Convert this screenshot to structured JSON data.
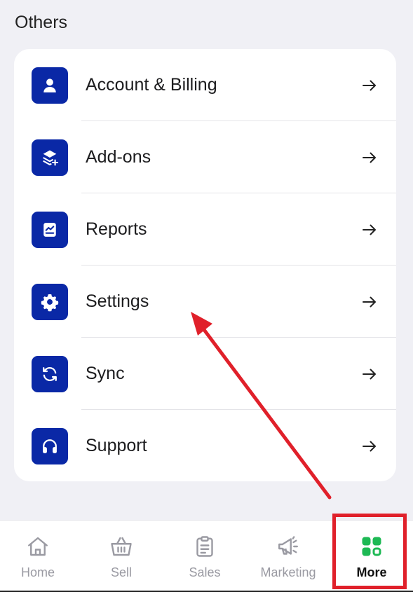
{
  "section": {
    "title": "Others"
  },
  "menu": [
    {
      "label": "Account & Billing",
      "icon": "person-icon"
    },
    {
      "label": "Add-ons",
      "icon": "layers-plus-icon"
    },
    {
      "label": "Reports",
      "icon": "report-chart-icon"
    },
    {
      "label": "Settings",
      "icon": "gear-icon"
    },
    {
      "label": "Sync",
      "icon": "sync-icon"
    },
    {
      "label": "Support",
      "icon": "headphones-icon"
    }
  ],
  "nav": [
    {
      "label": "Home",
      "icon": "home-icon"
    },
    {
      "label": "Sell",
      "icon": "basket-icon"
    },
    {
      "label": "Sales",
      "icon": "clipboard-icon"
    },
    {
      "label": "Marketing",
      "icon": "megaphone-icon"
    },
    {
      "label": "More",
      "icon": "grid-icon",
      "active": true
    }
  ],
  "colors": {
    "accent": "#0a28a6",
    "active_nav": "#1db954",
    "annotation": "#e0202a",
    "background": "#f0f0f5"
  }
}
